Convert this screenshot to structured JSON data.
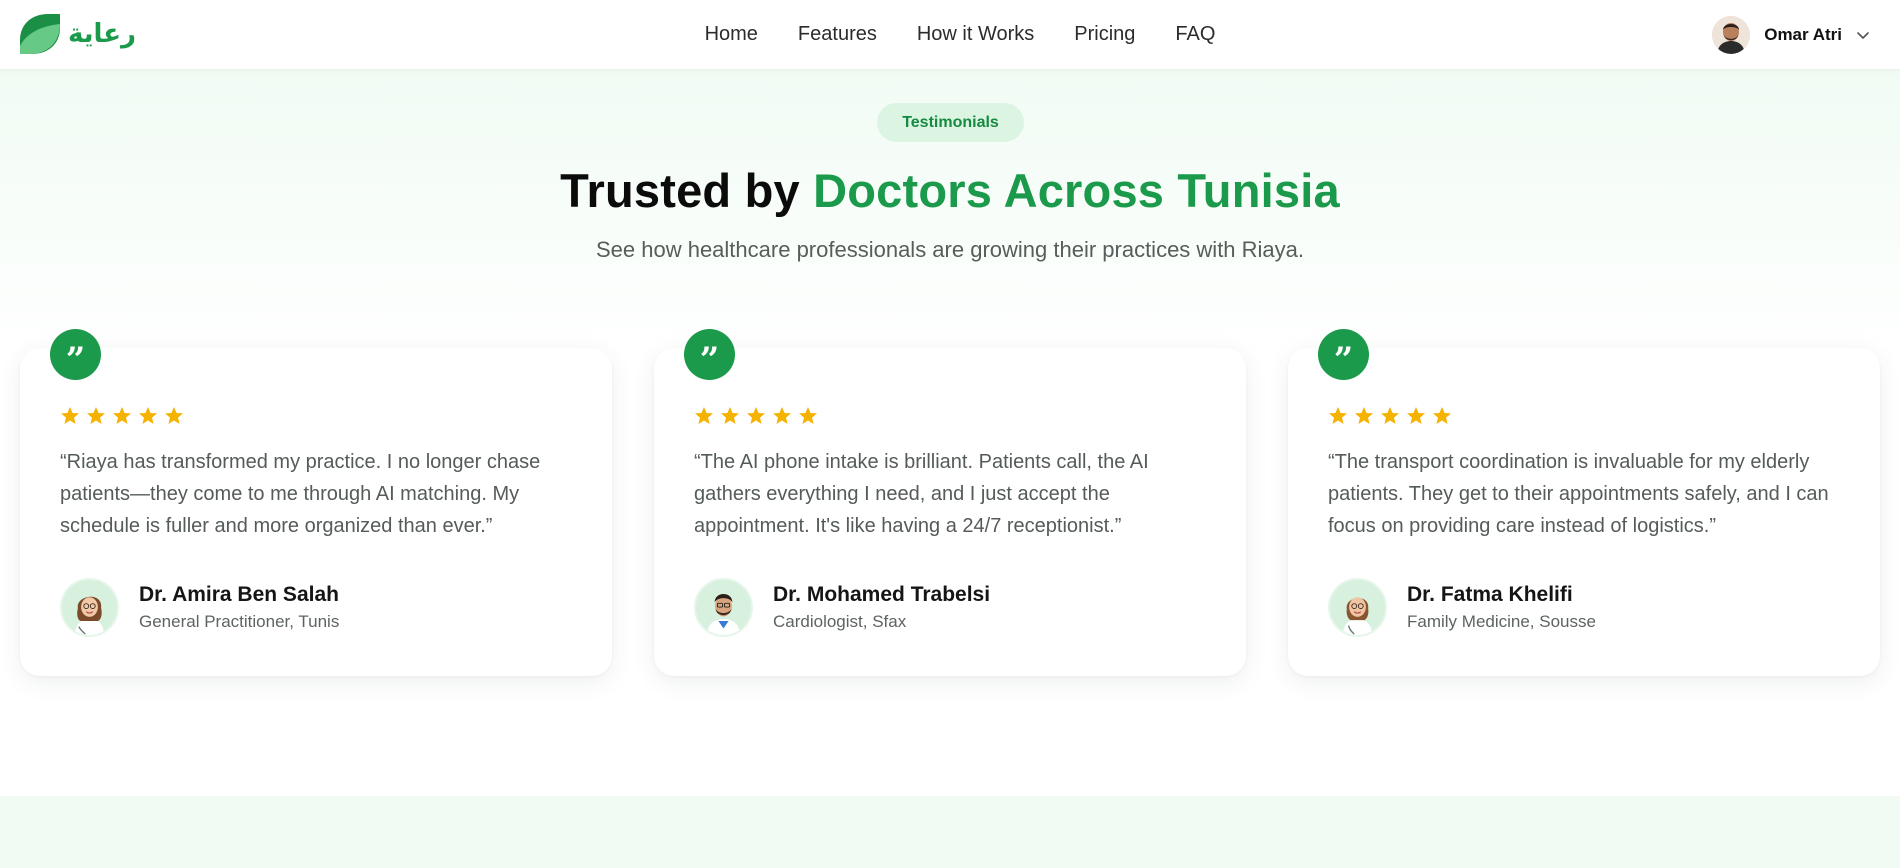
{
  "brand": {
    "logo_text": "رعاية",
    "accent_color": "#1a9a4a",
    "logo_icon": "leaf-icon"
  },
  "nav": {
    "items": [
      {
        "label": "Home"
      },
      {
        "label": "Features"
      },
      {
        "label": "How it Works"
      },
      {
        "label": "Pricing"
      },
      {
        "label": "FAQ"
      }
    ]
  },
  "user": {
    "name": "Omar Atri",
    "menu_icon": "chevron-down-icon"
  },
  "testimonials": {
    "badge": "Testimonials",
    "headline_prefix": "Trusted by ",
    "headline_accent": "Doctors Across Tunisia",
    "subtitle": "See how healthcare professionals are growing their practices with Riaya.",
    "star_color": "#f5b300",
    "cards": [
      {
        "rating": 5,
        "quote": "“Riaya has transformed my practice. I no longer chase patients—they come to me through AI matching. My schedule is fuller and more organized than ever.”",
        "name": "Dr. Amira Ben Salah",
        "role": "General Practitioner, Tunis"
      },
      {
        "rating": 5,
        "quote": "“The AI phone intake is brilliant. Patients call, the AI gathers everything I need, and I just accept the appointment. It's like having a 24/7 receptionist.”",
        "name": "Dr. Mohamed Trabelsi",
        "role": "Cardiologist, Sfax"
      },
      {
        "rating": 5,
        "quote": "“The transport coordination is invaluable for my elderly patients. They get to their appointments safely, and I can focus on providing care instead of logistics.”",
        "name": "Dr. Fatma Khelifi",
        "role": "Family Medicine, Sousse"
      }
    ]
  }
}
